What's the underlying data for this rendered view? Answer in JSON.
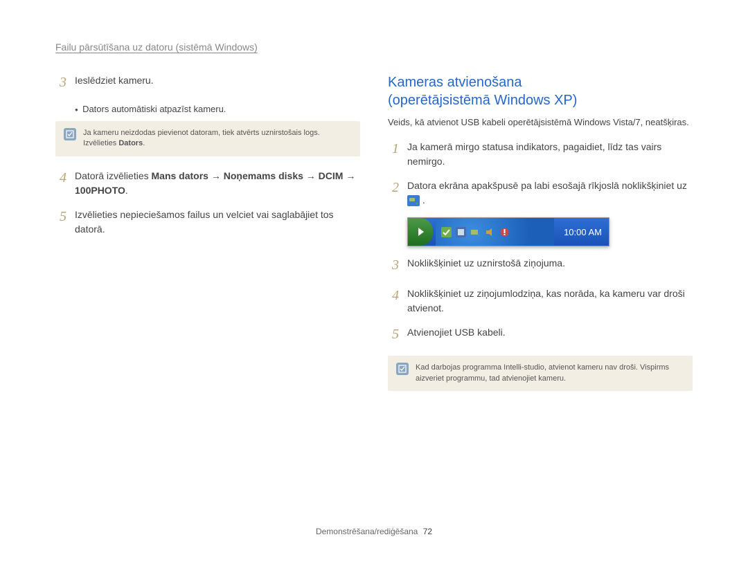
{
  "header": "Failu pārsūtīšana uz datoru (sistēmā Windows)",
  "left": {
    "step3_text": "Ieslēdziet kameru.",
    "bullet": "Dators automātiski atpazīst kameru.",
    "note1_a": "Ja kameru neizdodas pievienot datoram, tiek atvērts uznirstošais logs. Izvēlieties ",
    "note1_b_bold": "Dators",
    "note1_c": ".",
    "step4_a": "Datorā izvēlieties ",
    "step4_b_bold": "Mans dators → Noņemams disks → DCIM → 100PHOTO",
    "step4_c": ".",
    "step5": "Izvēlieties nepieciešamos failus un velciet vai saglabājiet tos datorā."
  },
  "right": {
    "title_line1": "Kameras atvienošana",
    "title_line2": "(operētājsistēmā Windows XP)",
    "subnote": "Veids, kā atvienot USB kabeli operētājsistēmā Windows Vista/7, neatšķiras.",
    "s1": "Ja kamerā mirgo statusa indikators, pagaidiet, līdz tas vairs nemirgo.",
    "s2_a": "Datora ekrāna apakšpusē pa labi esošajā rīkjoslā noklikšķiniet uz ",
    "s2_b": ".",
    "taskbar_time": "10:00 AM",
    "s3": "Noklikšķiniet uz uznirstošā ziņojuma.",
    "s4": "Noklikšķiniet uz ziņojumlodziņa, kas norāda, ka kameru var droši atvienot.",
    "s5": "Atvienojiet USB kabeli.",
    "note2": "Kad darbojas programma Intelli-studio, atvienot kameru nav droši. Vispirms aizveriet programmu, tad atvienojiet kameru."
  },
  "footer": {
    "section": "Demonstrēšana/rediģēšana",
    "page": "72"
  },
  "nums": {
    "n1": "1",
    "n2": "2",
    "n3": "3",
    "n4": "4",
    "n5": "5"
  }
}
